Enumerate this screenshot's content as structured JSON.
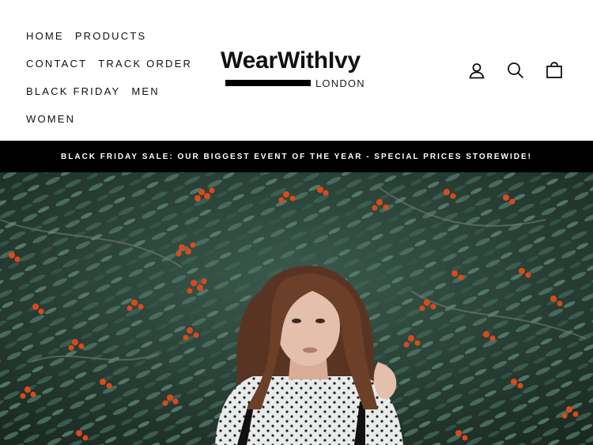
{
  "nav": {
    "items": [
      {
        "label": "HOME"
      },
      {
        "label": "PRODUCTS"
      },
      {
        "label": "CONTACT"
      },
      {
        "label": "TRACK ORDER"
      },
      {
        "label": "BLACK FRIDAY"
      },
      {
        "label": "MEN"
      },
      {
        "label": "WOMEN"
      }
    ]
  },
  "logo": {
    "main": "WearWithIvy",
    "sub": "LONDON"
  },
  "icons": [
    "account-icon",
    "search-icon",
    "cart-icon"
  ],
  "announcement": {
    "text": "BLACK FRIDAY SALE: OUR BIGGEST EVENT OF THE YEAR - SPECIAL PRICES STOREWIDE!"
  },
  "colors": {
    "text": "#111111",
    "announcement_bg": "#000000",
    "announcement_text": "#ffffff",
    "foliage": "#2f4a3f",
    "berries": "#d94a1e"
  }
}
